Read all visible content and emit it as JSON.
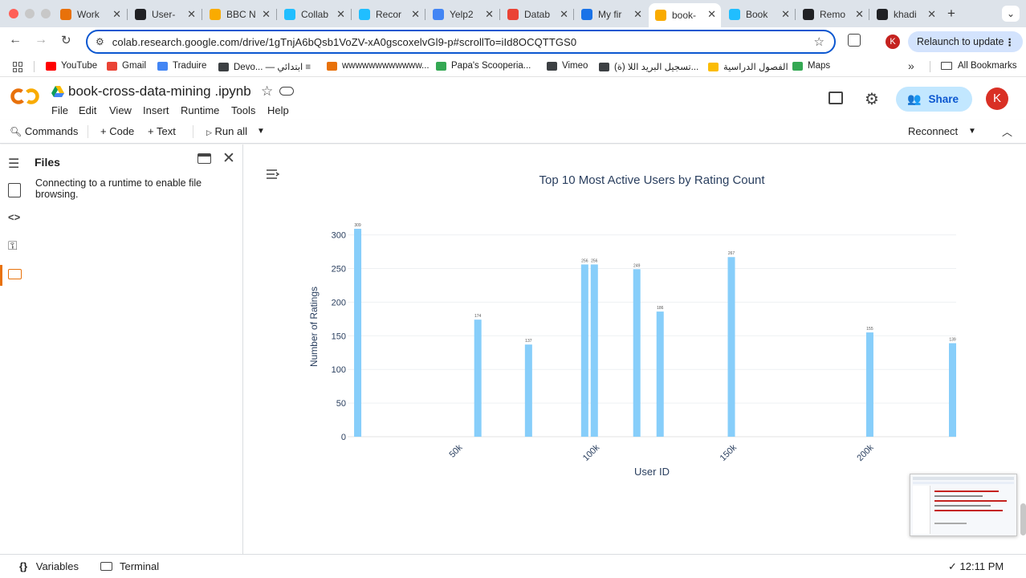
{
  "tabs": [
    {
      "title": "Work",
      "favicon": "layers-icon",
      "color": "#e8710a"
    },
    {
      "title": "User-",
      "favicon": "openai-icon",
      "color": "#202124"
    },
    {
      "title": "BBC N",
      "favicon": "colab-icon",
      "color": "#f9ab00"
    },
    {
      "title": "Collab",
      "favicon": "kaggle-icon",
      "color": "#20beff"
    },
    {
      "title": "Recor",
      "favicon": "kaggle-icon",
      "color": "#20beff"
    },
    {
      "title": "Yelp2",
      "favicon": "dataset-icon",
      "color": "#4285f4"
    },
    {
      "title": "Datab",
      "favicon": "gmail-icon",
      "color": "#ea4335"
    },
    {
      "title": "My fir",
      "favicon": "bookmark-icon",
      "color": "#1a73e8"
    },
    {
      "title": "book-",
      "favicon": "colab-icon",
      "color": "#f9ab00"
    },
    {
      "title": "Book",
      "favicon": "kaggle-icon",
      "color": "#20beff"
    },
    {
      "title": "Remo",
      "favicon": "openai-icon",
      "color": "#202124"
    },
    {
      "title": "khadi",
      "favicon": "github-icon",
      "color": "#202124"
    }
  ],
  "new_tab_label": "+",
  "address": {
    "url": "colab.research.google.com/drive/1gTnjA6bQsb1VoZV-xA0gscoxelvGl9-p#scrollTo=iId8OCQTTGS0"
  },
  "profile_initial": "K",
  "relaunch_label": "Relaunch to update",
  "bookmarks": [
    {
      "label": "YouTube",
      "color": "#ff0000"
    },
    {
      "label": "Gmail",
      "color": "#ea4335"
    },
    {
      "label": "Traduire",
      "color": "#4285f4"
    },
    {
      "label": "Devo... — ابتدائي ≡",
      "color": "#3c4043"
    },
    {
      "label": "wwwwwwwwwwww...",
      "color": "#e8710a"
    },
    {
      "label": "Papa's Scooperia...",
      "color": "#34a853"
    },
    {
      "label": "Vimeo",
      "color": "#3c4043"
    },
    {
      "label": "(ة) تسجيل البريد اللا...",
      "color": "#3c4043"
    },
    {
      "label": "الفصول الدراسية",
      "color": "#fbbc04"
    },
    {
      "label": "Maps",
      "color": "#34a853"
    }
  ],
  "more_bookmarks": "»",
  "all_bookmarks": "All Bookmarks",
  "notebook": {
    "title": "book-cross-data-mining .ipynb",
    "menus": [
      "File",
      "Edit",
      "View",
      "Insert",
      "Runtime",
      "Tools",
      "Help"
    ],
    "share_label": "Share",
    "avatar": "K"
  },
  "commands": {
    "commands": "Commands",
    "code": "+ Code",
    "text": "+ Text",
    "run_all": "Run all",
    "reconnect": "Reconnect"
  },
  "files_panel": {
    "title": "Files",
    "message": "Connecting to a runtime to enable file browsing."
  },
  "status": {
    "variables": "Variables",
    "terminal": "Terminal",
    "time": "12:11 PM",
    "check": "✓"
  },
  "chart_data": {
    "type": "bar",
    "title": "Top 10 Most Active Users by Rating Count",
    "xlabel": "User ID",
    "ylabel": "Number of Ratings",
    "x_ticks": [
      "50k",
      "100k",
      "150k",
      "200k"
    ],
    "x_tick_values": [
      50000,
      100000,
      150000,
      200000
    ],
    "xlim": [
      8000,
      230000
    ],
    "ylim": [
      0,
      315
    ],
    "y_ticks": [
      0,
      50,
      100,
      150,
      200,
      250,
      300
    ],
    "color": "#87cefa",
    "bars": [
      {
        "x": 11676,
        "value": 309
      },
      {
        "x": 55500,
        "value": 174
      },
      {
        "x": 74000,
        "value": 137
      },
      {
        "x": 94500,
        "value": 256
      },
      {
        "x": 98000,
        "value": 256
      },
      {
        "x": 113500,
        "value": 249
      },
      {
        "x": 122000,
        "value": 186
      },
      {
        "x": 148000,
        "value": 267
      },
      {
        "x": 198500,
        "value": 155
      },
      {
        "x": 230000,
        "value": 139
      }
    ]
  }
}
